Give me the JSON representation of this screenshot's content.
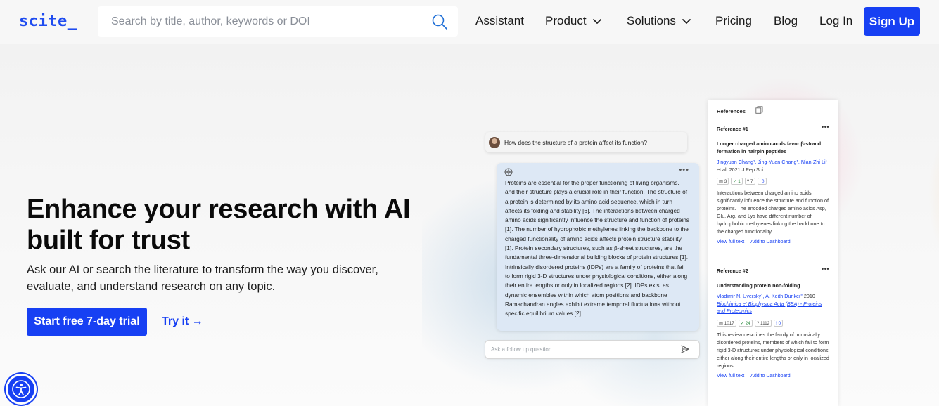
{
  "header": {
    "logo": "scite_",
    "search_placeholder": "Search by title, author, keywords or DOI",
    "nav": [
      {
        "label": "Assistant"
      },
      {
        "label": "Product"
      },
      {
        "label": "Solutions"
      },
      {
        "label": "Pricing"
      },
      {
        "label": "Blog"
      },
      {
        "label": "Log In"
      }
    ],
    "signup_label": "Sign Up"
  },
  "hero": {
    "headline": "Enhance your research with AI built for trust",
    "subtext": "Ask our AI or search the literature to transform the way you discover, evaluate, and understand research on any topic.",
    "cta_label": "Start free 7-day trial",
    "try_label": "Try it →"
  },
  "chat": {
    "question": "How does the structure of a protein affect its function?",
    "answer": "Proteins are essential for the proper functioning of living organisms, and their structure plays a crucial role in their function. The structure of a protein is determined by its amino acid sequence, which in turn affects its folding and stability [6]. The interactions between charged amino acids significantly influence the structure and function of proteins [1]. The number of hydrophobic methylenes linking the backbone to the charged functionality of amino acids affects protein structure stability [1]. Protein secondary structures, such as β-sheet structures, are the fundamental three-dimensional building blocks of protein structures [1]. Intrinsically disordered proteins (IDPs) are a family of proteins that fail to form rigid 3-D structures under physiological conditions, either along their entire lengths or only in localized regions [2]. IDPs exist as dynamic ensembles within which atom positions and backbone Ramachandran angles exhibit extreme temporal fluctuations without specific equilibrium values [2].",
    "followup_placeholder": "Ask a follow up question..."
  },
  "references": {
    "title": "References",
    "items": [
      {
        "label": "Reference #1",
        "title": "Longer charged amino acids favor β-strand formation in hairpin peptides",
        "authors_linked": "Jingyuan Chang¹, Jing-Yuan Chang¹, Nian-Zhi Li¹",
        "authors_rest": " et al. 2021 J Pep Sci",
        "journal": "",
        "metrics": [
          "3",
          "1",
          "7",
          "0"
        ],
        "summary": "Interactions between charged amino acids significantly influence the structure and function of proteins. The encoded charged amino acids Asp, Glu, Arg, and Lys have different number of hydrophobic methylenes linking the backbone to the charged functionality...",
        "view_label": "View full text",
        "add_label": "Add to Dashboard"
      },
      {
        "label": "Reference #2",
        "title": "Understanding protein non-folding",
        "authors_linked": "Vladimir N. Uversky¹, A. Keith Dunker²",
        "authors_rest": " 2010",
        "journal": "Biochimica et Biophysica Acta (BBA) - Proteins and Proteomics",
        "metrics": [
          "1017",
          "24",
          "1112",
          "0"
        ],
        "summary": "This review describes the family of intrinsically disordered proteins, members of which fail to form rigid 3-D structures under physiological conditions, either along their entire lengths or only in localized regions...",
        "view_label": "View full text",
        "add_label": "Add to Dashboard"
      }
    ]
  },
  "colors": {
    "brand": "#1740f3",
    "answer_bg": "#dde8f5"
  }
}
